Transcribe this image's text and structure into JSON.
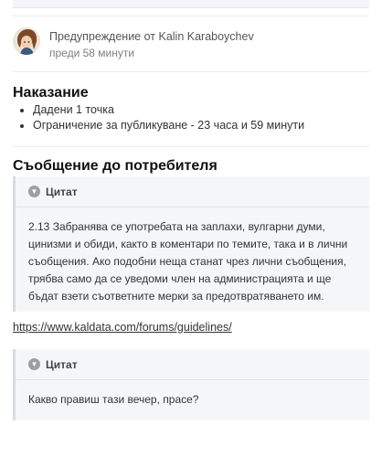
{
  "warning": {
    "title": "Предупреждение от Kalin Karaboychev",
    "time": "преди 58 минути",
    "avatar_icon": "user-avatar"
  },
  "punishment": {
    "heading": "Наказание",
    "items": [
      "Дадени 1 точка",
      "Ограничение за публикуване - 23 часа и 59 минути"
    ]
  },
  "message": {
    "heading": "Съобщение до потребителя",
    "quote1": {
      "label": "Цитат",
      "text": "2.13 Забранява се употребата на заплахи, вулгарни думи, цинизми и обиди, както в коментари по темите, така и в лични съобщения. Ако подобни неща станат чрез лични съобщения, трябва само да се уведоми член на администрацията и ще бъдат взети съответните мерки за предотвратяването им."
    },
    "link": "https://www.kaldata.com/forums/guidelines/",
    "quote2": {
      "label": "Цитат",
      "text": "Какво правиш тази вечер, прасе?"
    }
  }
}
